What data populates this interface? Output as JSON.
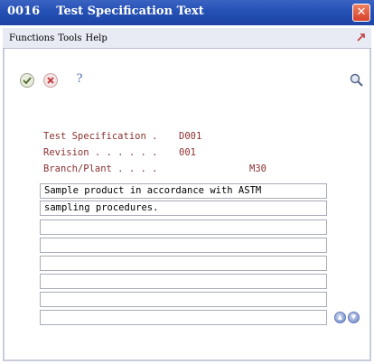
{
  "window": {
    "code": "0016",
    "title": "Test Specification Text",
    "close_glyph": "✕"
  },
  "menu": {
    "items": [
      "Functions",
      "Tools",
      "Help"
    ]
  },
  "toolbar": {
    "ok_glyph": "✓",
    "cancel_glyph": "✕",
    "help_glyph": "?"
  },
  "form": {
    "test_spec_label": "Test Specification .",
    "test_spec_value": "D001",
    "revision_label": "Revision . . . . . .",
    "revision_value": "001",
    "branch_label": "Branch/Plant . . . .",
    "branch_value": "M30"
  },
  "text_lines": [
    "Sample product in accordance with ASTM",
    "sampling procedures.",
    "",
    "",
    "",
    "",
    "",
    ""
  ],
  "scroll": {
    "up_glyph": "▲",
    "down_glyph": "▼"
  }
}
